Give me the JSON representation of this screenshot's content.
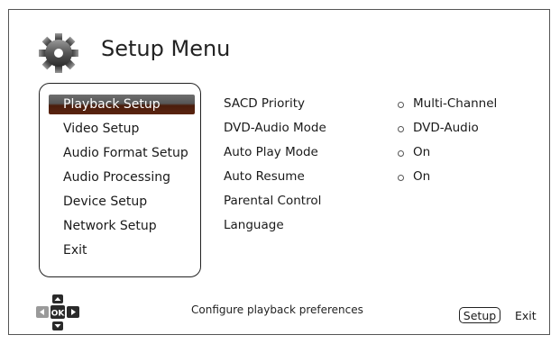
{
  "header": {
    "title": "Setup Menu",
    "icon": "gear-icon"
  },
  "menu": {
    "items": [
      {
        "label": "Playback Setup",
        "selected": true
      },
      {
        "label": "Video Setup"
      },
      {
        "label": "Audio Format Setup"
      },
      {
        "label": "Audio Processing"
      },
      {
        "label": "Device Setup"
      },
      {
        "label": "Network Setup"
      },
      {
        "label": "Exit"
      }
    ]
  },
  "options": [
    {
      "label": "SACD Priority",
      "value": "Multi-Channel"
    },
    {
      "label": "DVD-Audio Mode",
      "value": "DVD-Audio"
    },
    {
      "label": "Auto Play Mode",
      "value": "On"
    },
    {
      "label": "Auto Resume",
      "value": "On"
    },
    {
      "label": "Parental Control"
    },
    {
      "label": "Language"
    }
  ],
  "footer": {
    "nav_icon": "dpad-ok-icon",
    "ok_label": "OK",
    "hint": "Configure playback preferences",
    "setup_key": "Setup",
    "exit_label": "Exit"
  },
  "colors": {
    "selection_top": "#6e6e6e",
    "selection_bottom": "#4a1d0c"
  }
}
